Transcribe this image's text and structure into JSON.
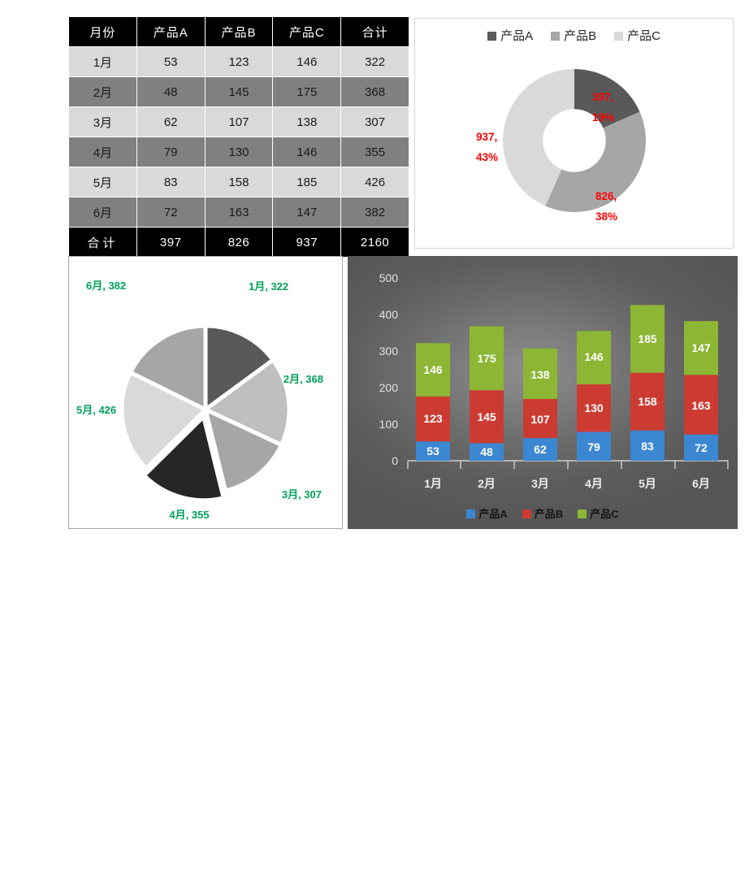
{
  "table": {
    "headers": [
      "月份",
      "产品A",
      "产品B",
      "产品C",
      "合计"
    ],
    "rows": [
      {
        "month": "1月",
        "a": "53",
        "b": "123",
        "c": "146",
        "total": "322"
      },
      {
        "month": "2月",
        "a": "48",
        "b": "145",
        "c": "175",
        "total": "368"
      },
      {
        "month": "3月",
        "a": "62",
        "b": "107",
        "c": "138",
        "total": "307"
      },
      {
        "month": "4月",
        "a": "79",
        "b": "130",
        "c": "146",
        "total": "355"
      },
      {
        "month": "5月",
        "a": "83",
        "b": "158",
        "c": "185",
        "total": "426"
      },
      {
        "month": "6月",
        "a": "72",
        "b": "163",
        "c": "147",
        "total": "382"
      }
    ],
    "total_row": {
      "month": "合计",
      "a": "397",
      "b": "826",
      "c": "937",
      "total": "2160"
    }
  },
  "donut": {
    "legend": [
      {
        "label": "产品A",
        "color": "#595959"
      },
      {
        "label": "产品B",
        "color": "#a6a6a6"
      },
      {
        "label": "产品C",
        "color": "#d9d9d9"
      }
    ],
    "labels": [
      "397,",
      "19%",
      "826,",
      "38%",
      "937,",
      "43%"
    ],
    "label_color": "#ff0000"
  },
  "pie": {
    "labels": [
      "1月, 322",
      "2月, 368",
      "3月, 307",
      "4月, 355",
      "5月, 426",
      "6月, 382"
    ],
    "label_color": "#00a15a"
  },
  "bar": {
    "yticks": [
      "0",
      "100",
      "200",
      "300",
      "400",
      "500"
    ],
    "xticks": [
      "1月",
      "2月",
      "3月",
      "4月",
      "5月",
      "6月"
    ],
    "legend": [
      {
        "label": "产品A",
        "color": "#3b87d1"
      },
      {
        "label": "产品B",
        "color": "#cc3b32"
      },
      {
        "label": "产品C",
        "color": "#8cb633"
      }
    ],
    "values_a": [
      "53",
      "48",
      "62",
      "79",
      "83",
      "72"
    ],
    "values_b": [
      "123",
      "145",
      "107",
      "130",
      "158",
      "163"
    ],
    "values_c": [
      "146",
      "175",
      "138",
      "146",
      "185",
      "147"
    ]
  },
  "chart_data": [
    {
      "type": "table",
      "title": "月份产品销量表",
      "columns": [
        "月份",
        "产品A",
        "产品B",
        "产品C",
        "合计"
      ],
      "rows": [
        [
          "1月",
          53,
          123,
          146,
          322
        ],
        [
          "2月",
          48,
          145,
          175,
          368
        ],
        [
          "3月",
          62,
          107,
          138,
          307
        ],
        [
          "4月",
          79,
          130,
          146,
          355
        ],
        [
          "5月",
          83,
          158,
          185,
          426
        ],
        [
          "6月",
          72,
          163,
          147,
          382
        ],
        [
          "合计",
          397,
          826,
          937,
          2160
        ]
      ]
    },
    {
      "type": "pie",
      "variant": "doughnut",
      "title": "",
      "categories": [
        "产品A",
        "产品B",
        "产品C"
      ],
      "values": [
        397,
        826,
        937
      ],
      "percentages": [
        19,
        38,
        43
      ],
      "data_labels": [
        "397, 19%",
        "826, 38%",
        "937, 43%"
      ],
      "colors": [
        "#595959",
        "#a6a6a6",
        "#d9d9d9"
      ],
      "legend": "top",
      "label_color": "#ff0000",
      "hole_ratio": 0.44
    },
    {
      "type": "pie",
      "title": "",
      "categories": [
        "1月",
        "2月",
        "3月",
        "4月",
        "5月",
        "6月"
      ],
      "values": [
        322,
        368,
        307,
        355,
        426,
        382
      ],
      "data_labels": [
        "1月, 322",
        "2月, 368",
        "3月, 307",
        "4月, 355",
        "5月, 426",
        "6月, 382"
      ],
      "colors": [
        "#595959",
        "#bfbfbf",
        "#a6a6a6",
        "#262626",
        "#d9d9d9",
        "#a6a6a6"
      ],
      "legend": "none",
      "label_color": "#00a15a",
      "exploded": true
    },
    {
      "type": "bar",
      "variant": "stacked-column",
      "title": "",
      "categories": [
        "1月",
        "2月",
        "3月",
        "4月",
        "5月",
        "6月"
      ],
      "series": [
        {
          "name": "产品A",
          "values": [
            53,
            48,
            62,
            79,
            83,
            72
          ],
          "color": "#3b87d1"
        },
        {
          "name": "产品B",
          "values": [
            123,
            145,
            107,
            130,
            158,
            163
          ],
          "color": "#cc3b32"
        },
        {
          "name": "产品C",
          "values": [
            146,
            175,
            138,
            146,
            185,
            147
          ],
          "color": "#8cb633"
        }
      ],
      "xlabel": "",
      "ylabel": "",
      "ylim": [
        0,
        500
      ],
      "yticks": [
        0,
        100,
        200,
        300,
        400,
        500
      ],
      "grid": false,
      "legend": "bottom",
      "plot_background": "dark-gray-radial-gradient"
    }
  ]
}
